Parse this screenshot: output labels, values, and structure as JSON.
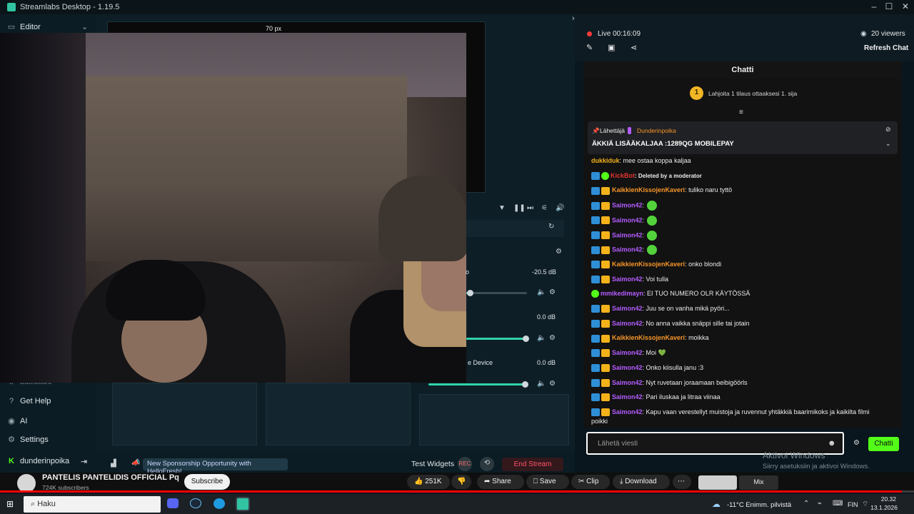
{
  "window": {
    "title": "Streamlabs Desktop - 1.19.5"
  },
  "left_nav": {
    "editor_label": "Editor",
    "items": [
      {
        "label": "Dashboard"
      },
      {
        "label": "Get Help"
      },
      {
        "label": "AI"
      },
      {
        "label": "Settings"
      }
    ],
    "user": "dunderinpoika"
  },
  "canvas": {
    "ruler_value": "70 px"
  },
  "mixer": {
    "rows": [
      {
        "name": "o",
        "db": "-20.5 dB",
        "level": 0.06
      },
      {
        "name": "",
        "db": "0.0 dB",
        "level": 0.98
      },
      {
        "name": "e Device",
        "db": "0.0 dB",
        "level": 0.98
      }
    ]
  },
  "status_bar": {
    "sponsorship": "New Sponsorship Opportunity with HelloFresh!",
    "test_widgets": "Test Widgets",
    "rec_label": "REC",
    "end_stream": "End Stream"
  },
  "chat_header": {
    "live_label": "Live 00:16:09",
    "viewers": "20 viewers",
    "refresh_chat": "Refresh Chat",
    "chat_title": "Chatti"
  },
  "gift": {
    "coin_number": "1",
    "text": "Lahjoita 1 tilaus ottaaksesi 1. sija"
  },
  "pinned": {
    "sender_label": "Lähettäjä",
    "sender": "Dunderinpoika",
    "message": "ÄKKIÄ LISÄÄKALJAA :1289QG MOBILEPAY"
  },
  "messages": [
    {
      "user": "dukkiduk",
      "text": ": mee ostaa koppa kaljaa",
      "color": "#f4b21b",
      "badges": []
    },
    {
      "user": "KickBot",
      "text": ": Deleted by a moderator",
      "color": "#e3342f",
      "badges": [
        "b",
        "g"
      ],
      "bold_text": true
    },
    {
      "user": "KaikkienKissojenKaveri",
      "text": ": tuliko naru tyttö",
      "color": "#f7962a",
      "badges": [
        "b",
        "c"
      ]
    },
    {
      "user": "Saimon42",
      "text": ":",
      "color": "#b45cff",
      "badges": [
        "b",
        "c"
      ],
      "emote": true
    },
    {
      "user": "Saimon42",
      "text": ":",
      "color": "#b45cff",
      "badges": [
        "b",
        "c"
      ],
      "emote": true
    },
    {
      "user": "Saimon42",
      "text": ":",
      "color": "#b45cff",
      "badges": [
        "b",
        "c"
      ],
      "emote": true
    },
    {
      "user": "Saimon42",
      "text": ":",
      "color": "#b45cff",
      "badges": [
        "b",
        "c"
      ],
      "emote": true
    },
    {
      "user": "KaikkienKissojenKaveri",
      "text": ": onko blondi",
      "color": "#f7962a",
      "badges": [
        "b",
        "c"
      ]
    },
    {
      "user": "Saimon42",
      "text": ": Voi tulla",
      "color": "#b45cff",
      "badges": [
        "b",
        "c"
      ]
    },
    {
      "user": "mmikedimayn",
      "text": ": EI TUO NUMERO OLR KÄYTÖSSÄ",
      "color": "#b45cff",
      "badges": [
        "g"
      ]
    },
    {
      "user": "Saimon42",
      "text": ": Juu se on vanha mikä pyöri...",
      "color": "#b45cff",
      "badges": [
        "b",
        "c"
      ]
    },
    {
      "user": "Saimon42",
      "text": ": No anna vaikka snäppi sille tai jotain",
      "color": "#b45cff",
      "badges": [
        "b",
        "c"
      ]
    },
    {
      "user": "KaikkienKissojenKaveri",
      "text": ": moikka",
      "color": "#f7962a",
      "badges": [
        "b",
        "c"
      ]
    },
    {
      "user": "Saimon42",
      "text": ": Moi 💚",
      "color": "#b45cff",
      "badges": [
        "b",
        "c"
      ]
    },
    {
      "user": "Saimon42",
      "text": ": Onko kiisulla janu :3",
      "color": "#b45cff",
      "badges": [
        "b",
        "c"
      ]
    },
    {
      "user": "Saimon42",
      "text": ": Nyt ruvetaan joraamaan beibigöörls",
      "color": "#b45cff",
      "badges": [
        "b",
        "c"
      ]
    },
    {
      "user": "Saimon42",
      "text": ": Pari iluskaa ja litraa viinaa",
      "color": "#b45cff",
      "badges": [
        "b",
        "c"
      ]
    },
    {
      "user": "Saimon42",
      "text": ": Kapu vaan verestellyt muistoja ja ruvennut yhtäkkiä baarimikoks ja kaikilta filmi",
      "color": "#b45cff",
      "badges": [
        "b",
        "c"
      ]
    }
  ],
  "message_continuation": "poikki",
  "chat_input": {
    "placeholder": "Lähetä viesti",
    "send": "Chatti"
  },
  "windows_watermark": {
    "line1": "Aktivoi Windows",
    "line2": "Siirry asetuksiin ja aktivoi Windows."
  },
  "youtube": {
    "channel": "PANTELIS PANTELIDIS OFFICIAL Pq",
    "subscribers": "724K subscribers",
    "subscribe": "Subscribe",
    "likes": "251K",
    "share": "Share",
    "save": "Save",
    "clip": "Clip",
    "download": "Download",
    "mix": "Mix",
    "progress": 0.987
  },
  "taskbar": {
    "search_placeholder": "Haku",
    "weather": "-11°C  Enimm. pilvistä",
    "lang": "FIN",
    "time": "20.32",
    "date": "13.1.2026"
  }
}
